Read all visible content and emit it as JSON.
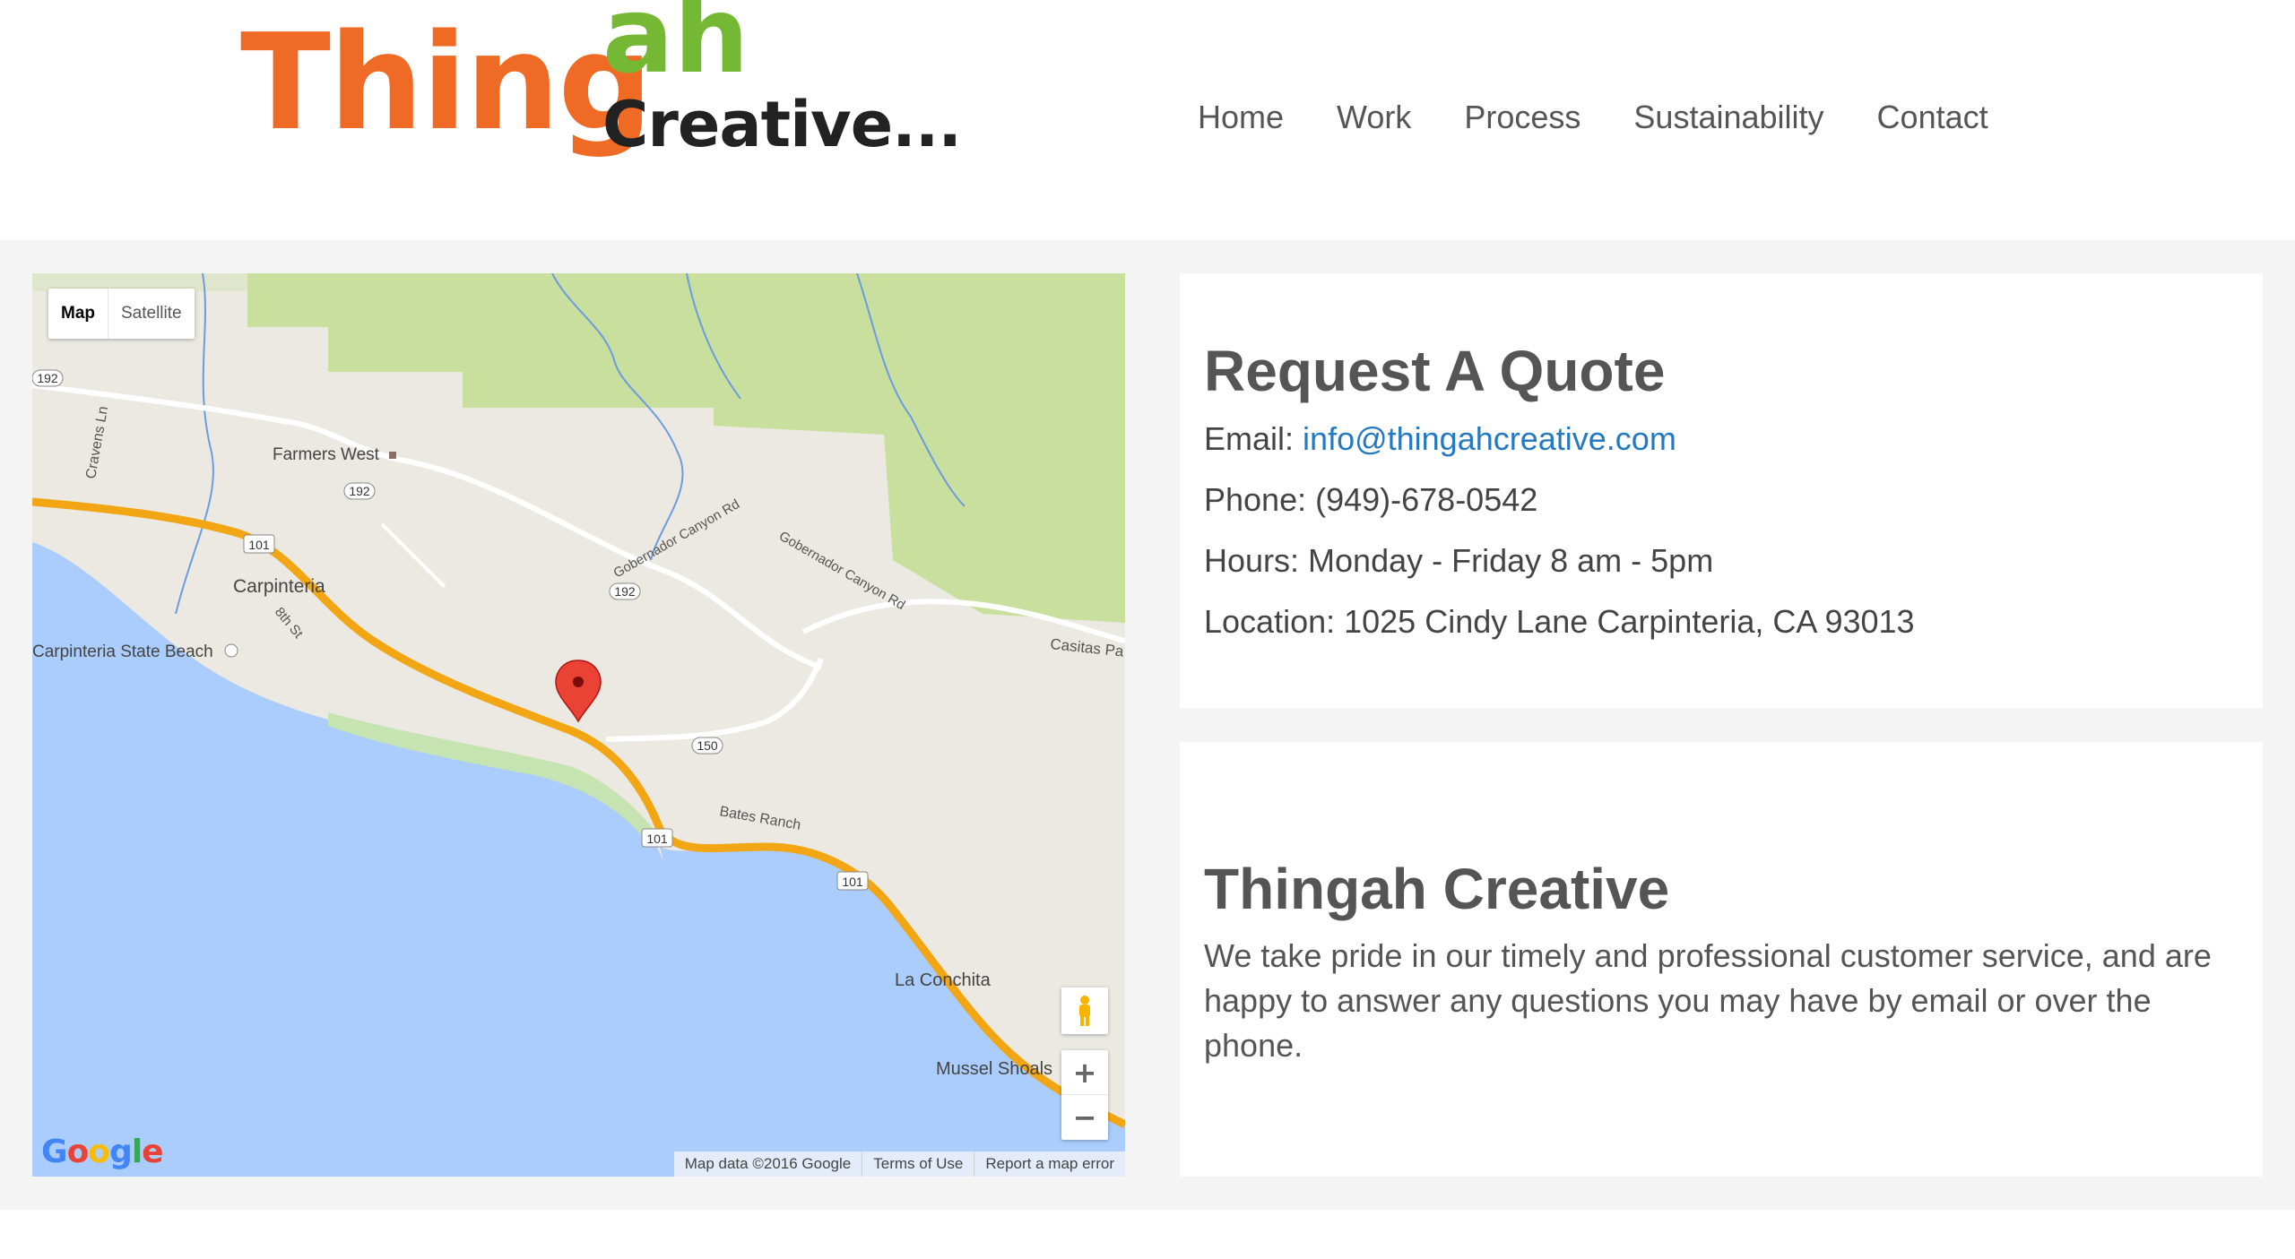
{
  "logo": {
    "part1": "Thing",
    "part2": "ah",
    "part3": "Creative..."
  },
  "nav": {
    "items": [
      "Home",
      "Work",
      "Process",
      "Sustainability",
      "Contact"
    ]
  },
  "map": {
    "type_buttons": [
      "Map",
      "Satellite"
    ],
    "labels": {
      "farmers_west": "Farmers West",
      "cravens_ln": "Cravens Ln",
      "carpinteria": "Carpinteria",
      "eighth_st": "8th St",
      "state_beach": "Carpinteria State Beach",
      "gobernador1": "Gobernador Canyon Rd",
      "gobernador2": "Gobernador Canyon Rd",
      "casitas": "Casitas Pa",
      "bates_ranch": "Bates Ranch",
      "la_conchita": "La Conchita",
      "mussel_shoals": "Mussel Shoals",
      "r192a": "192",
      "r192b": "192",
      "r192c": "192",
      "r101a": "101",
      "r101b": "101",
      "r101c": "101",
      "r150": "150"
    },
    "zoom_in": "+",
    "zoom_out": "−",
    "google": "Google",
    "footer": [
      "Map data ©2016 Google",
      "Terms of Use",
      "Report a map error"
    ]
  },
  "quote": {
    "title": "Request A Quote",
    "email_label": "Email:",
    "email": "info@thingahcreative.com",
    "phone": "Phone: (949)-678-0542",
    "hours": "Hours: Monday - Friday 8 am - 5pm",
    "location": "Location: 1025 Cindy Lane Carpinteria, CA 93013"
  },
  "about": {
    "title": "Thingah Creative",
    "text": "We take pride in our timely and professional customer service, and are happy to answer any questions you may have by email or over the phone."
  },
  "colors": {
    "logo_orange": "#ef6a24",
    "logo_green": "#74b834",
    "link": "#2579bf",
    "water": "#abcdfd",
    "park": "#c9df9e",
    "highway": "#f3a613"
  }
}
